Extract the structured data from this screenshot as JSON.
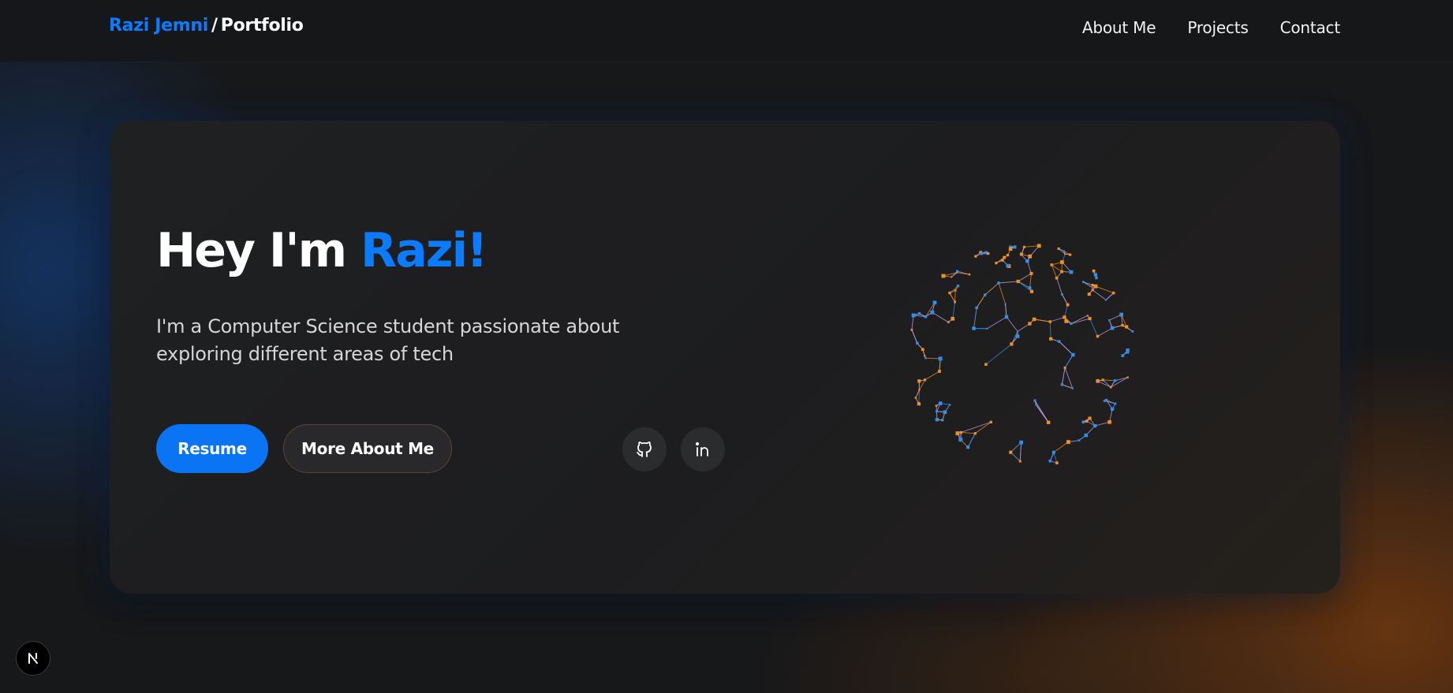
{
  "header": {
    "brand_name": "Razi Jemni",
    "brand_separator": "/",
    "brand_suffix": "Portfolio",
    "nav": [
      {
        "label": "About Me"
      },
      {
        "label": "Projects"
      },
      {
        "label": "Contact"
      }
    ]
  },
  "hero": {
    "title_prefix": "Hey I'm ",
    "title_name": "Razi!",
    "subtitle": "I'm a Computer Science student passionate about exploring different areas of tech",
    "primary_button": "Resume",
    "secondary_button": "More About Me",
    "social_icons": [
      "github-icon",
      "linkedin-icon"
    ],
    "visual": "network-globe-icon"
  },
  "badge": {
    "icon": "nextjs-icon",
    "letter": "N"
  },
  "colors": {
    "accent": "#0b7bff",
    "button_primary": "#0b74f5",
    "globe_blue": "#2f8ff0",
    "globe_orange": "#f0901e",
    "background": "#17181a",
    "card": "#1f2022"
  }
}
